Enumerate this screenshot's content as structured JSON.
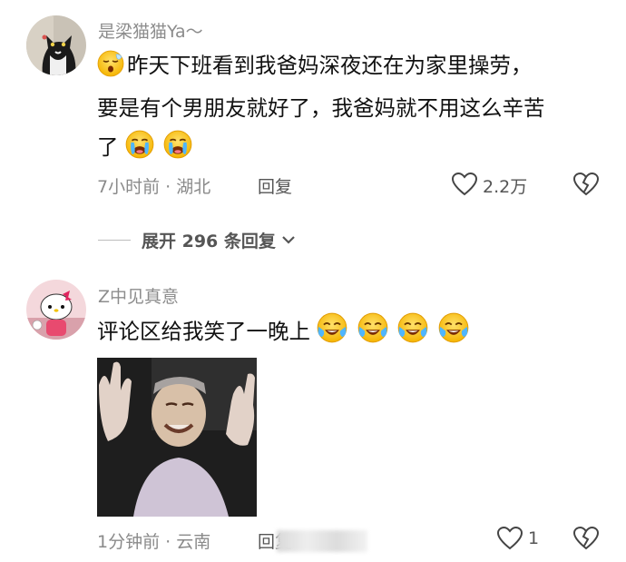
{
  "comments": [
    {
      "username": "是梁猫猫Ya～",
      "line1": "昨天下班看到我爸妈深夜还在为家里操劳，",
      "line2": "要是有个男朋友就好了，我爸妈就不用这么辛苦",
      "line3": "了",
      "time_location": "7小时前 · 湖北",
      "reply_label": "回复",
      "like_count": "2.2万",
      "icons": [
        "sleepy-face-icon",
        "loudly-crying-face-icon",
        "loudly-crying-face-icon"
      ]
    },
    {
      "username": "Z中见真意",
      "line1": "评论区给我笑了一晚上",
      "time_location": "1分钟前 · 云南",
      "reply_label": "回复",
      "like_count": "1",
      "icons": [
        "crying-laughing-face-icon",
        "crying-laughing-face-icon",
        "crying-laughing-face-icon",
        "crying-laughing-face-icon"
      ]
    }
  ],
  "expand": {
    "label": "展开 296 条回复"
  },
  "colors": {
    "meta": "#8a8a8a",
    "text": "#111111",
    "username": "#8c8c8c"
  }
}
